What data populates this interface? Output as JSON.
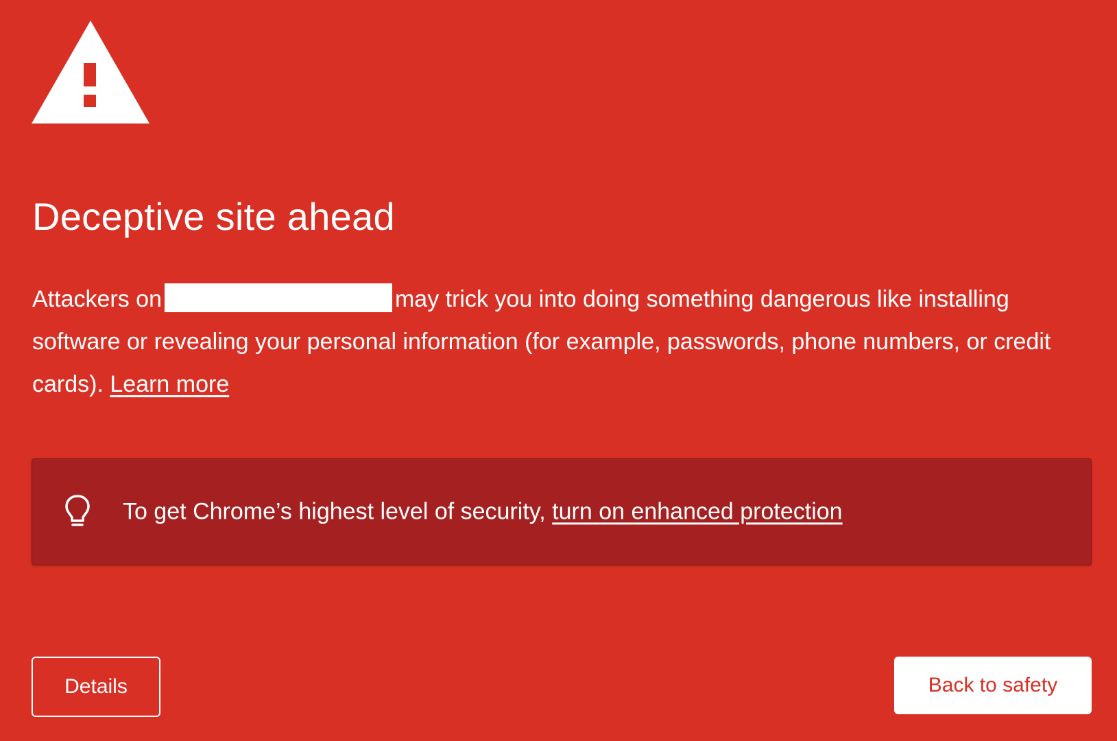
{
  "page": {
    "background_color": "#d93025",
    "title": "Deceptive site ahead",
    "body_prefix": "Attackers on",
    "body_main": "may trick you into doing something dangerous like installing software or revealing your personal information (for example, passwords, phone numbers, or credit cards).",
    "learn_more": "Learn more"
  },
  "icons": {
    "warning": "warning-triangle-icon",
    "tip": "lightbulb-icon"
  },
  "tip": {
    "background_color": "#a52020",
    "text": "To get Chrome’s highest level of security,",
    "link": "turn on enhanced protection"
  },
  "buttons": {
    "details": "Details",
    "back_to_safety": "Back to safety",
    "back_to_safety_text_color": "#d93025"
  }
}
